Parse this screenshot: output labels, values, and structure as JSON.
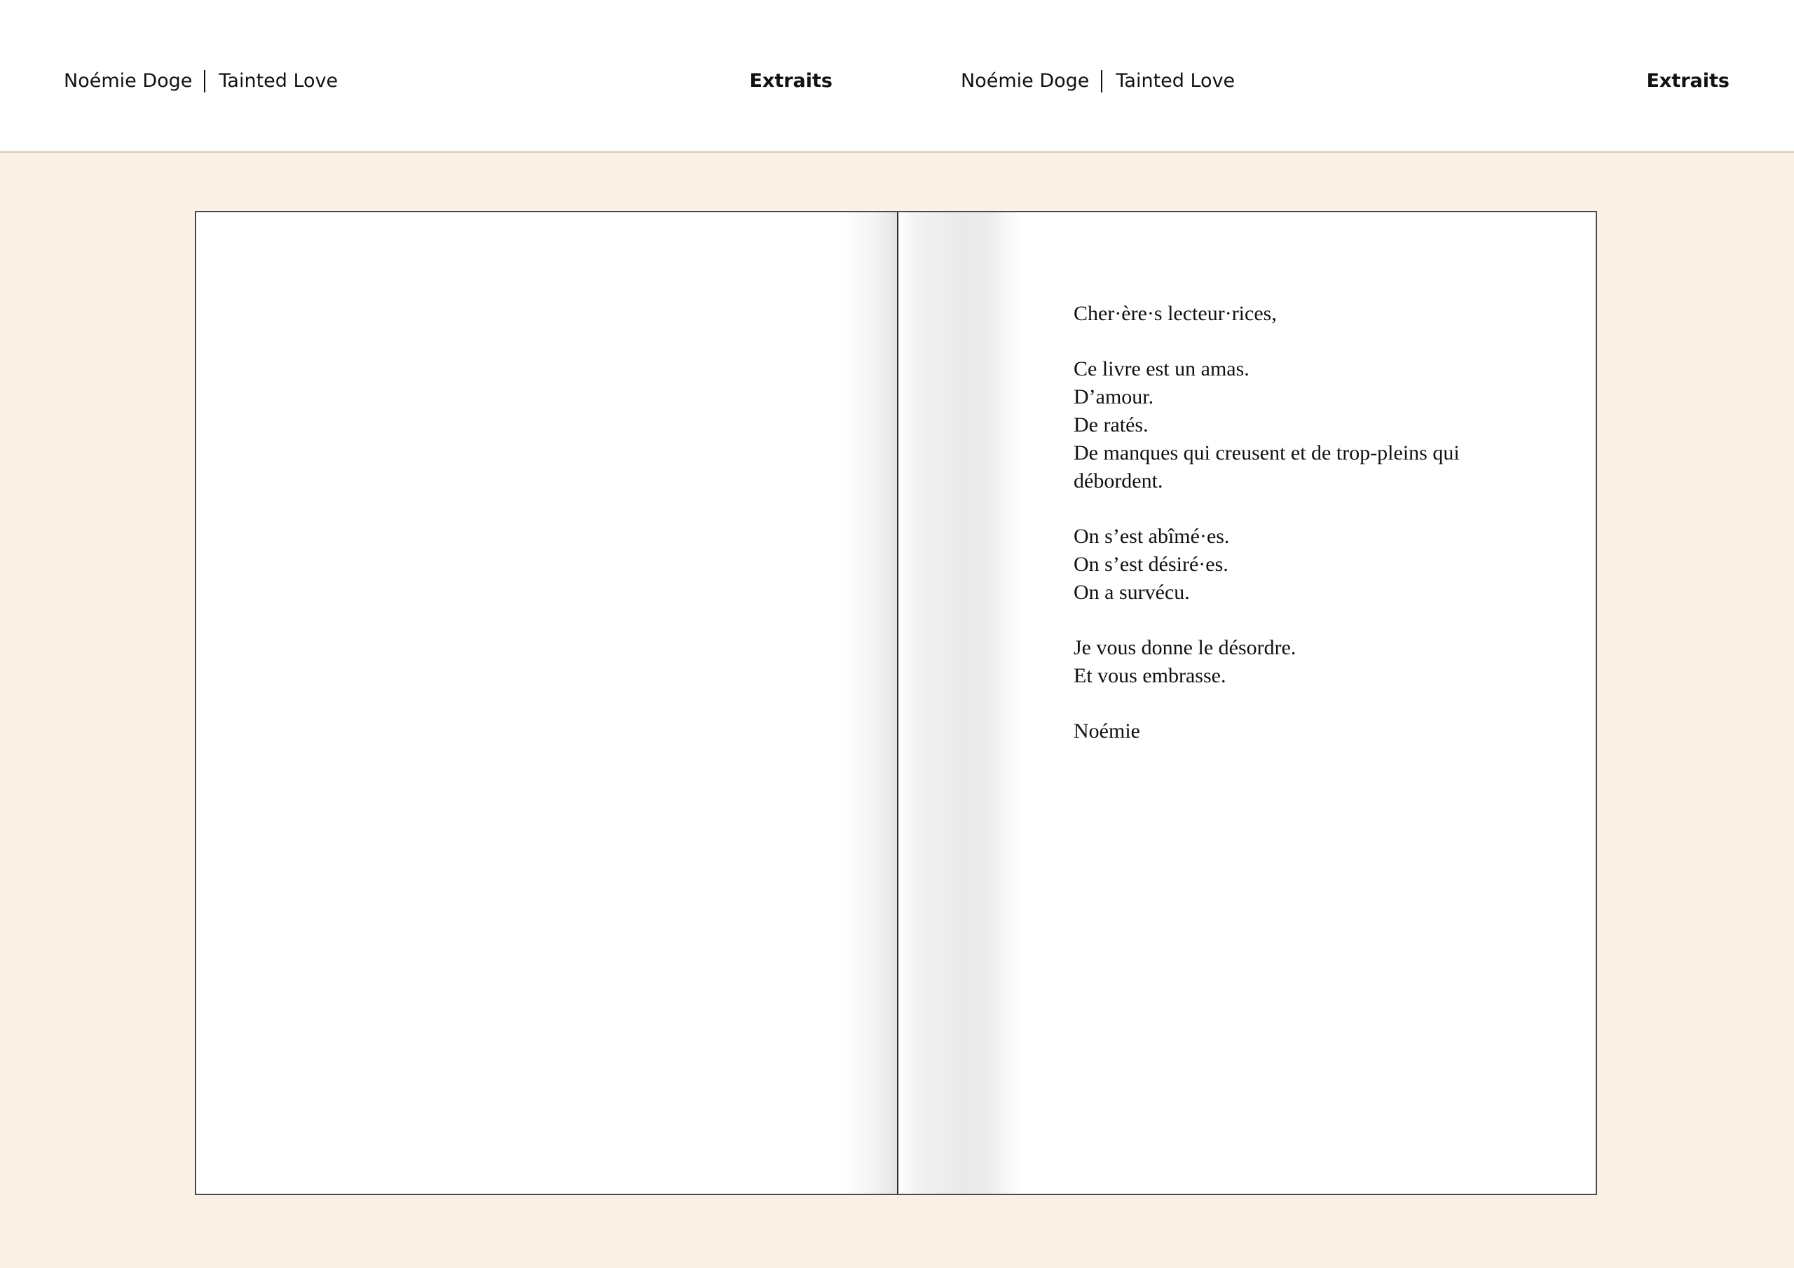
{
  "header": {
    "left": {
      "author": "Noémie Doge",
      "title": "Tainted Love",
      "section": "Extraits"
    },
    "right": {
      "author": "Noémie Doge",
      "title": "Tainted Love",
      "section": "Extraits"
    }
  },
  "letter": {
    "greeting": "Cher·ère·s lecteur·rices,",
    "stanza1": [
      "Ce livre est un amas.",
      "D’amour.",
      "De ratés.",
      "De manques qui creusent et de trop-pleins qui débordent."
    ],
    "stanza2": [
      "On s’est abîmé·es.",
      "On s’est désiré·es.",
      "On a survécu."
    ],
    "stanza3": [
      "Je vous donne le désordre.",
      "Et vous embrasse."
    ],
    "signature": "Noémie"
  }
}
